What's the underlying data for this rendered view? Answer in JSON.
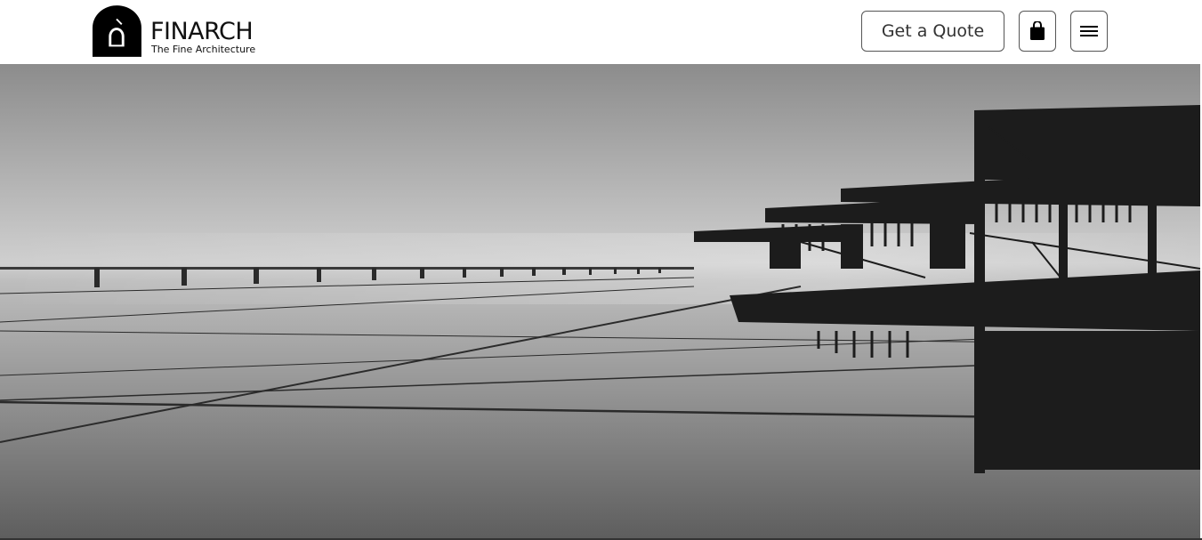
{
  "header": {
    "logo": {
      "name": "FINARCH",
      "tagline": "The Fine Architecture",
      "icon": "arch-door-icon"
    },
    "quote_button_label": "Get a Quote",
    "cart_icon": "shopping-bag-icon",
    "menu_icon": "hamburger-menu-icon"
  },
  "hero": {
    "image": "black-and-white-modern-building-photo"
  },
  "colors": {
    "text": "#111111",
    "border": "#555555",
    "background": "#ffffff"
  }
}
